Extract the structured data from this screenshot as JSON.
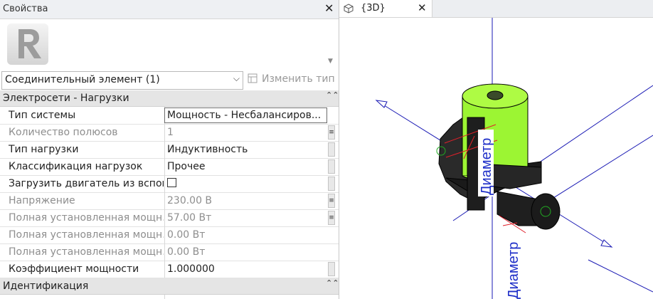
{
  "properties_panel": {
    "title": "Свойства",
    "type_selector": {
      "value": "Соединительный элемент (1)"
    },
    "edit_type_label": "Изменить тип",
    "groups": [
      {
        "label": "Электросети - Нагрузки",
        "rows": [
          {
            "name": "Тип системы",
            "value": "Мощность - Несбалансиров...",
            "readonly": false,
            "selected": true
          },
          {
            "name": "Количество полюсов",
            "value": "1",
            "readonly": true
          },
          {
            "name": "Тип нагрузки",
            "value": "Индуктивность",
            "readonly": false
          },
          {
            "name": "Классификация нагрузок",
            "value": "Прочее",
            "readonly": false
          },
          {
            "name": "Загрузить двигатель из вспом...",
            "value": "",
            "readonly": false,
            "checkbox": true,
            "checked": false
          },
          {
            "name": "Напряжение",
            "value": "230.00 В",
            "readonly": true
          },
          {
            "name": "Полная установленная мощн...",
            "value": "57.00 Вт",
            "readonly": true
          },
          {
            "name": "Полная установленная мощн...",
            "value": "0.00 Вт",
            "readonly": true
          },
          {
            "name": "Полная установленная мощн...",
            "value": "0.00 Вт",
            "readonly": true
          },
          {
            "name": "Коэффициент мощности",
            "value": "1.000000",
            "readonly": false
          }
        ]
      },
      {
        "label": "Идентификация",
        "rows": []
      }
    ]
  },
  "view": {
    "tab_label": "{3D}",
    "dimension_labels": [
      "Диаметр",
      "Диаметр"
    ]
  },
  "colors": {
    "accent_green": "#9cf533",
    "axis_blue": "#1a1ab4",
    "dim_red": "#e0202a",
    "dim_text": "#1f2fc8"
  }
}
